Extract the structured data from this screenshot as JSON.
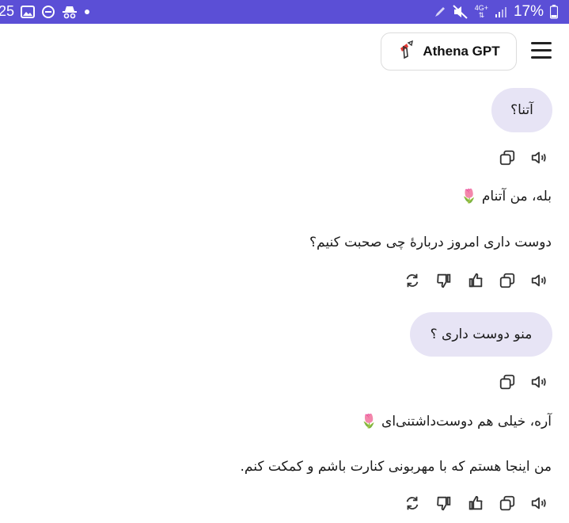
{
  "status_bar": {
    "time": "25",
    "network": "4G+",
    "battery": "17%",
    "left_icons": [
      "image-icon",
      "do-not-disturb-icon",
      "incognito-icon",
      "dot-icon"
    ],
    "right_icons": [
      "pen-icon",
      "mute-icon",
      "data-icon",
      "signal-icon",
      "battery-icon"
    ]
  },
  "header": {
    "title": "Athena GPT"
  },
  "messages": [
    {
      "role": "user",
      "text": "آتنا؟"
    },
    {
      "role": "assistant",
      "lines": [
        "بله، من آتنام 🌷",
        "دوست داری امروز دربارهٔ چی صحبت کنیم؟"
      ]
    },
    {
      "role": "user",
      "text": "منو دوست داری ؟"
    },
    {
      "role": "assistant",
      "lines": [
        "آره، خیلی هم دوست‌داشتنی‌ای 🌷",
        "من اینجا هستم که با مهربونی کنارت باشم و کمکت کنم."
      ]
    }
  ]
}
